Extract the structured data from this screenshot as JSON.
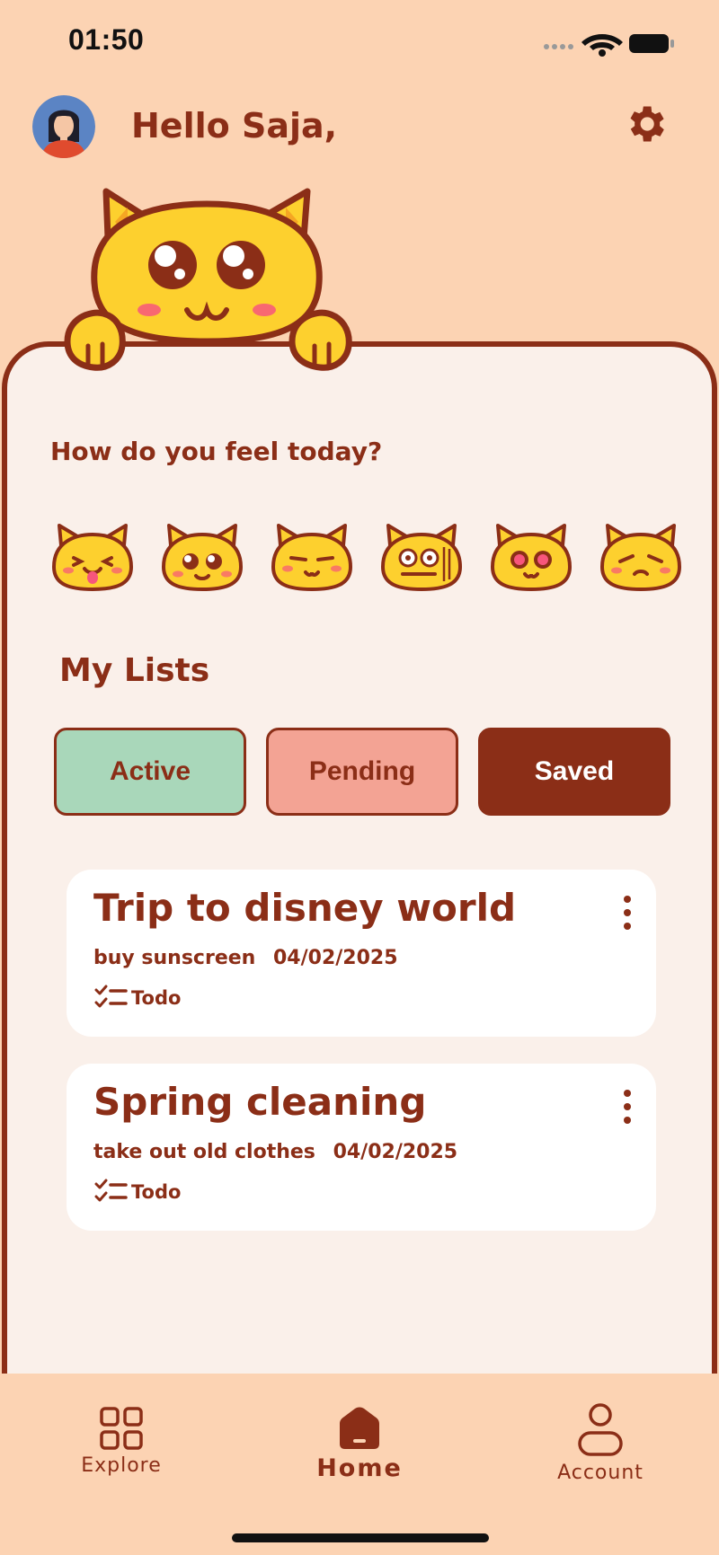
{
  "status_bar": {
    "time": "01:50"
  },
  "header": {
    "greeting": "Hello Saja,"
  },
  "mood_section": {
    "title": "How do you feel today?",
    "moods": [
      "playful",
      "teary",
      "annoyed",
      "confused",
      "in-love",
      "sad"
    ]
  },
  "lists_section": {
    "title": "My Lists",
    "tabs": {
      "active": "Active",
      "pending": "Pending",
      "saved": "Saved"
    },
    "selected_tab": "Saved"
  },
  "lists": [
    {
      "title": "Trip to disney world",
      "task": "buy sunscreen",
      "date": "04/02/2025",
      "tag": "Todo"
    },
    {
      "title": "Spring cleaning",
      "task": "take out old clothes",
      "date": "04/02/2025",
      "tag": "Todo"
    }
  ],
  "bottom_nav": {
    "explore": "Explore",
    "home": "Home",
    "account": "Account",
    "selected": "Home"
  },
  "colors": {
    "background": "#FCD3B3",
    "accent": "#8B2E17",
    "panel": "#FAF0EA",
    "active_tab": "#A9D7BA",
    "pending_tab": "#F3A394",
    "mascot": "#FDD02E"
  }
}
